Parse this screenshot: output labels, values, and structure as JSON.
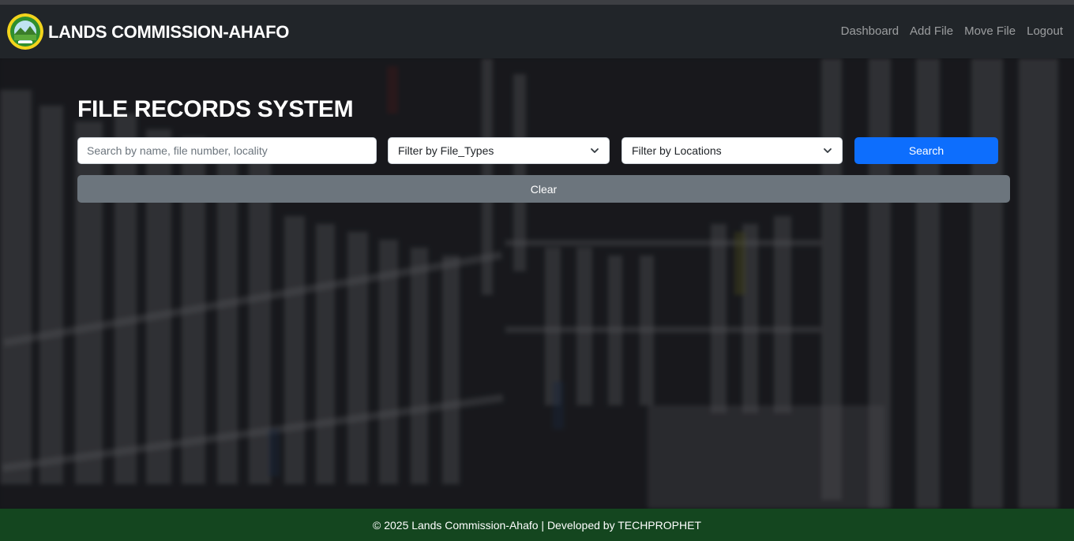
{
  "navbar": {
    "brand": "LANDS COMMISSION-AHAFO",
    "links": [
      "Dashboard",
      "Add File",
      "Move File",
      "Logout"
    ]
  },
  "main": {
    "title": "FILE RECORDS SYSTEM",
    "search": {
      "placeholder": "Search by name, file number, locality",
      "value": ""
    },
    "file_type_filter": {
      "selected": "Filter by File_Types"
    },
    "location_filter": {
      "selected": "Filter by Locations"
    },
    "search_button": "Search",
    "clear_button": "Clear"
  },
  "footer": {
    "text": "© 2025 Lands Commission-Ahafo | Developed by TECHPROPHET"
  },
  "colors": {
    "navbar": "#212529",
    "primary": "#0d6efd",
    "secondary": "#6c757d",
    "footer": "#14461f"
  },
  "icons": {
    "logo": "lands-commission-seal",
    "select_arrow": "chevron-down-icon"
  }
}
